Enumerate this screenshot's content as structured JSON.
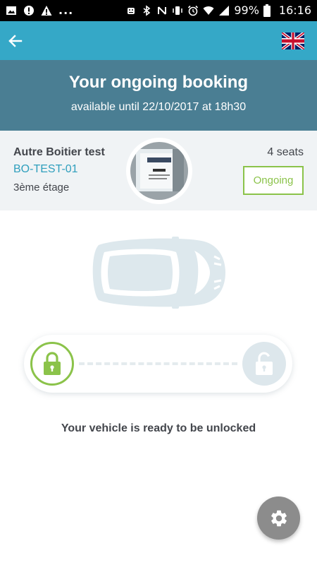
{
  "status_bar": {
    "left_icons": [
      "image-icon",
      "alert-circle-icon",
      "warning-icon"
    ],
    "overflow": "...",
    "right_icons": [
      "android-icon",
      "bluetooth-icon",
      "nfc-icon",
      "vibrate-icon",
      "alarm-icon",
      "wifi-icon",
      "signal-icon"
    ],
    "battery": "99%",
    "time": "16:16"
  },
  "app_bar": {
    "back_icon": "arrow-left-icon",
    "language_icon": "uk-flag-icon",
    "color": "#35a8c7"
  },
  "header": {
    "title": "Your ongoing booking",
    "subtitle": "available until 22/10/2017 at 18h30",
    "color": "#4a7e93"
  },
  "booking": {
    "name": "Autre Boitier test",
    "code": "BO-TEST-01",
    "floor": "3ème étage",
    "seats": "4 seats",
    "status": "Ongoing",
    "status_color": "#8bc34a",
    "code_color": "#2f9fbd"
  },
  "unlock": {
    "message": "Your vehicle is ready to be unlocked",
    "locked_icon": "lock-closed-icon",
    "unlocked_icon": "lock-open-icon",
    "accent": "#8bc34a"
  },
  "fab": {
    "icon": "gear-icon"
  }
}
